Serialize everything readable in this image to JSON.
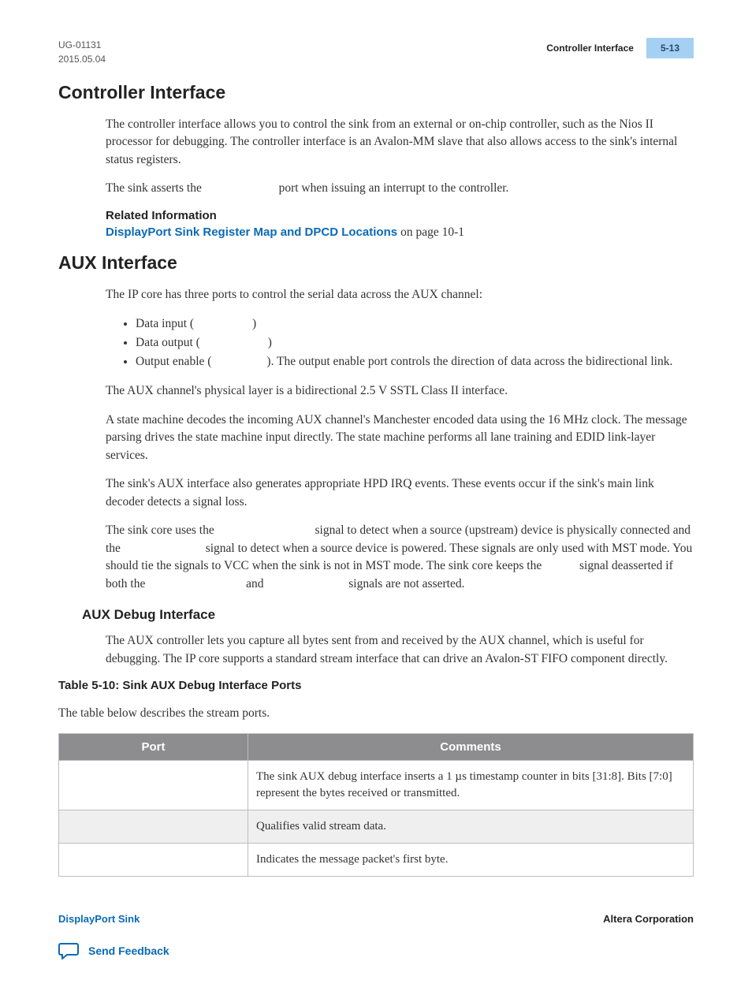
{
  "header": {
    "doc_id": "UG-01131",
    "date": "2015.05.04",
    "section_title": "Controller Interface",
    "page_num": "5-13"
  },
  "sections": {
    "controller": {
      "heading": "Controller Interface",
      "p1": "The controller interface allows you to control the sink from an external or on-chip controller, such as the Nios II processor for debugging. The controller interface is an Avalon-MM slave that also allows access to the sink's internal status registers.",
      "p2_a": "The sink asserts the ",
      "p2_b": " port when issuing an interrupt to the controller.",
      "related_label": "Related Information",
      "related_link": "DisplayPort Sink Register Map and DPCD Locations",
      "related_suffix": " on page 10-1"
    },
    "aux": {
      "heading": "AUX Interface",
      "p1": "The IP core has three ports to control the serial data across the AUX channel:",
      "bullets": {
        "b1_a": "Data input (",
        "b1_b": ")",
        "b2_a": "Data output (",
        "b2_b": ")",
        "b3_a": "Output enable (",
        "b3_b": "). The output enable port controls the direction of data across the bidirec­tional link."
      },
      "p2": "The AUX channel's physical layer is a bidirectional 2.5 V SSTL Class II interface.",
      "p3": "A state machine decodes the incoming AUX channel's Manchester encoded data using the 16 MHz clock. The message parsing drives the state machine input directly. The state machine performs all lane training and EDID link-layer services.",
      "p4": "The sink's AUX interface also generates appropriate HPD IRQ events. These events occur if the sink's main link decoder detects a signal loss.",
      "p5_a": "The sink core uses the ",
      "p5_b": " signal to detect when a source (upstream) device is physically connected and the ",
      "p5_c": " signal to detect when a source device is powered. These signals are only used with MST mode. You should tie the signals to VCC when the sink is not in MST mode. The sink core keeps the ",
      "p5_d": " signal deasserted if both the ",
      "p5_e": " and ",
      "p5_f": " signals are not asserted."
    },
    "aux_debug": {
      "heading": "AUX Debug Interface",
      "p1": "The AUX controller lets you capture all bytes sent from and received by the AUX channel, which is useful for debugging. The IP core supports a standard stream interface that can drive an Avalon-ST FIFO component directly."
    }
  },
  "table": {
    "title": "Table 5-10: Sink AUX Debug Interface Ports",
    "caption": "The table below describes the stream ports.",
    "headers": {
      "c1": "Port",
      "c2": "Comments"
    },
    "rows": [
      {
        "port": "",
        "comment": "The sink AUX debug interface inserts a 1 µs timestamp counter in bits [31:8]. Bits [7:0] represent the bytes received or transmitted."
      },
      {
        "port": "",
        "comment": "Qualifies valid stream data."
      },
      {
        "port": "",
        "comment": "Indicates the message packet's first byte."
      }
    ]
  },
  "footer": {
    "left": "DisplayPort Sink",
    "right": "Altera Corporation",
    "feedback": "Send Feedback"
  }
}
